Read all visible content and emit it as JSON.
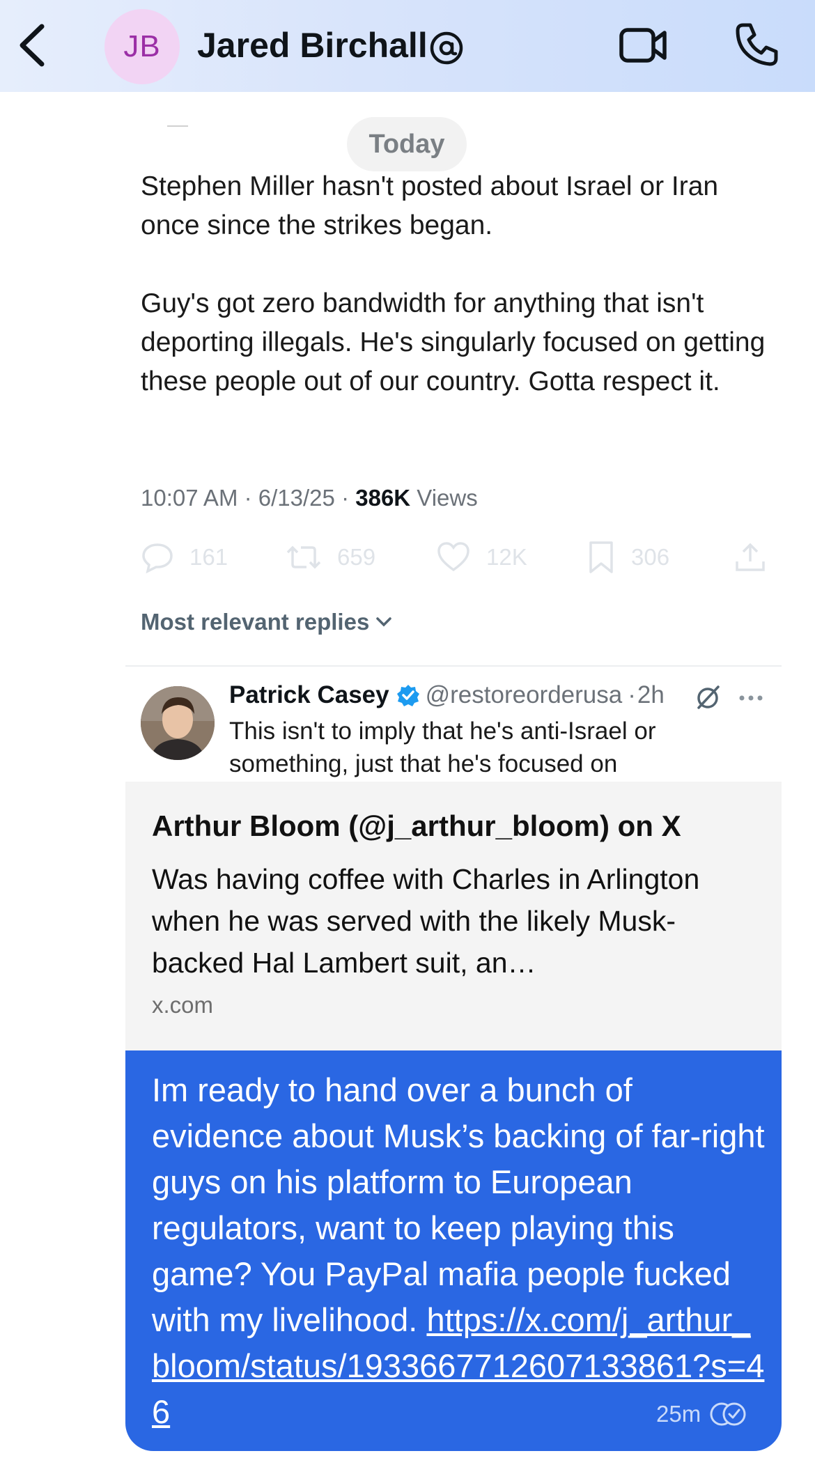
{
  "header": {
    "avatar_initials": "JB",
    "contact_name": "Jared Birchall",
    "icons": [
      "chevron-left-icon",
      "at-sign-icon",
      "video-camera-icon",
      "phone-icon"
    ]
  },
  "conversation": {
    "date_divider": "Today"
  },
  "tweet": {
    "paragraph_1": "Stephen Miller hasn't posted about Israel or Iran once since the strikes began.",
    "paragraph_2": "Guy's got zero bandwidth for anything that isn't deporting illegals. He's singularly focused on getting these people out of our country. Gotta respect it.",
    "time": "10:07 AM",
    "date": "6/13/25",
    "separator": "·",
    "views_count": "386K",
    "views_label": "Views",
    "replies": "161",
    "reposts": "659",
    "likes": "12K",
    "bookmarks": "306",
    "sort_label": "Most relevant replies"
  },
  "reply": {
    "name": "Patrick Casey",
    "handle": "@restoreorderusa",
    "age": "2h",
    "text": "This isn't to imply that he's anti-Israel or something, just that he's focused on"
  },
  "link_preview": {
    "title": "Arthur Bloom (@j_arthur_bloom) on X",
    "description": "Was having coffee with Charles in Arlington when he was served with the likely Musk-backed Hal Lambert suit, an…",
    "domain": "x.com"
  },
  "outgoing_message": {
    "text": "Im ready to hand over a bunch of evidence about Musk’s backing of far-right guys on his platform to European regulators, want to keep playing this game? You PayPal mafia people fucked with my livelihood.",
    "link": "https://x.com/j_arthur_bloom/status/1933667712607133861?s=46",
    "time": "25m"
  },
  "colors": {
    "bubble": "#2a67e3",
    "avatar_bg": "#f2d4f4",
    "avatar_text": "#9b2fa6",
    "verified": "#1d9bf0"
  }
}
